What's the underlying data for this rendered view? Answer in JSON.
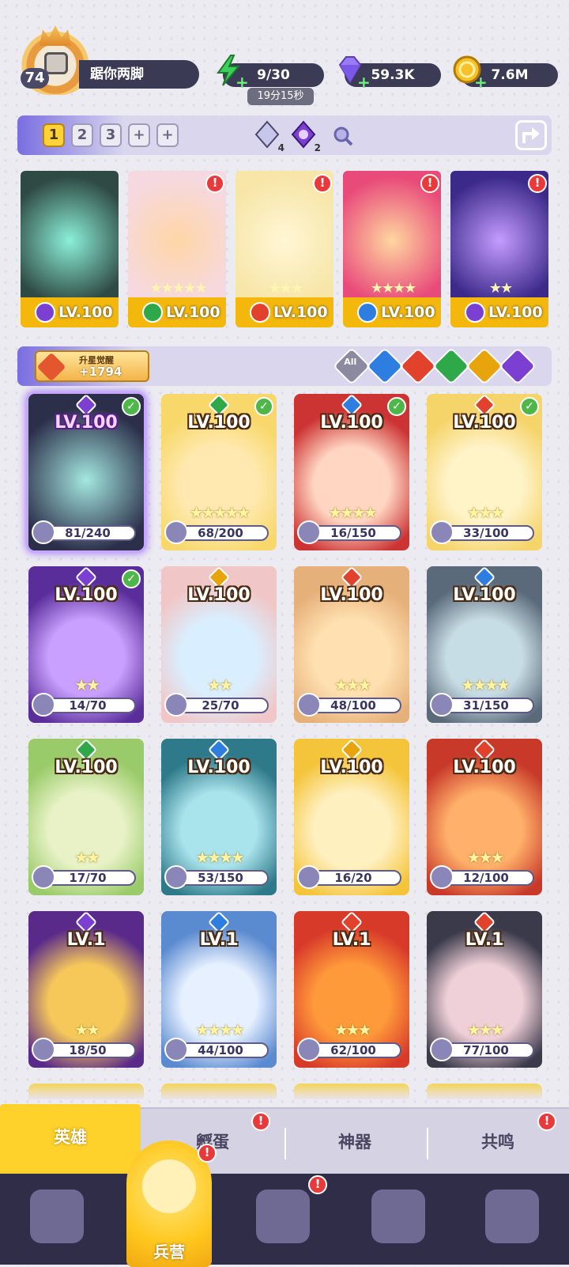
{
  "player": {
    "level": "74",
    "name": "踞你两脚"
  },
  "resources": {
    "energy": {
      "value": "9/30",
      "timer": "19分15秒",
      "icon": "lightning-icon",
      "color": "#3ccf5a"
    },
    "gems": {
      "value": "59.3K",
      "icon": "gem-icon",
      "color": "#8e6cf2"
    },
    "gold": {
      "value": "7.6M",
      "icon": "coin-icon",
      "color": "#f2b318"
    }
  },
  "team_bar": {
    "tabs": [
      "1",
      "2",
      "3",
      "+",
      "+"
    ],
    "active_tab": "1",
    "crystals": [
      {
        "icon": "white-crystal-icon",
        "count": "4"
      },
      {
        "icon": "moon-crystal-icon",
        "count": "2"
      }
    ]
  },
  "team": [
    {
      "level": "LV.100",
      "element": "moon",
      "stars": "",
      "alert": false
    },
    {
      "level": "LV.100",
      "element": "leaf",
      "stars": "★★★★★",
      "alert": true
    },
    {
      "level": "LV.100",
      "element": "fire",
      "stars": "★★★",
      "alert": true
    },
    {
      "level": "LV.100",
      "element": "water",
      "stars": "★★★★",
      "alert": true
    },
    {
      "level": "LV.100",
      "element": "moon",
      "stars": "★★",
      "alert": true
    }
  ],
  "awaken": {
    "label": "升星觉醒",
    "value": "+1794"
  },
  "filters": [
    "All",
    "water",
    "fire",
    "leaf",
    "light",
    "moon"
  ],
  "heroes": [
    {
      "level": "LV.100",
      "element": "moon",
      "stars": "",
      "progress": "81/240",
      "checked": true
    },
    {
      "level": "LV.100",
      "element": "leaf",
      "stars": "★★★★★",
      "progress": "68/200",
      "checked": true
    },
    {
      "level": "LV.100",
      "element": "water",
      "stars": "★★★★",
      "progress": "16/150",
      "checked": true
    },
    {
      "level": "LV.100",
      "element": "fire",
      "stars": "★★★",
      "progress": "33/100",
      "checked": true
    },
    {
      "level": "LV.100",
      "element": "moon",
      "stars": "★★",
      "progress": "14/70",
      "checked": true
    },
    {
      "level": "LV.100",
      "element": "light",
      "stars": "★★",
      "progress": "25/70",
      "checked": false
    },
    {
      "level": "LV.100",
      "element": "fire",
      "stars": "★★★",
      "progress": "48/100",
      "checked": false
    },
    {
      "level": "LV.100",
      "element": "water",
      "stars": "★★★★",
      "progress": "31/150",
      "checked": false
    },
    {
      "level": "LV.100",
      "element": "leaf",
      "stars": "★★",
      "progress": "17/70",
      "checked": false
    },
    {
      "level": "LV.100",
      "element": "water",
      "stars": "★★★★",
      "progress": "53/150",
      "checked": false
    },
    {
      "level": "LV.100",
      "element": "light",
      "stars": "",
      "progress": "16/20",
      "checked": false
    },
    {
      "level": "LV.100",
      "element": "fire",
      "stars": "★★★",
      "progress": "12/100",
      "checked": false
    },
    {
      "level": "LV.1",
      "element": "moon",
      "stars": "★★",
      "progress": "18/50",
      "checked": false
    },
    {
      "level": "LV.1",
      "element": "water",
      "stars": "★★★★",
      "progress": "44/100",
      "checked": false
    },
    {
      "level": "LV.1",
      "element": "fire",
      "stars": "★★★",
      "progress": "62/100",
      "checked": false
    },
    {
      "level": "LV.1",
      "element": "fire",
      "stars": "★★★",
      "progress": "77/100",
      "checked": false
    }
  ],
  "element_colors": {
    "moon": "#7b3fd1",
    "leaf": "#2fa84a",
    "fire": "#e2412b",
    "water": "#2d7ee0",
    "light": "#e8a40c",
    "All": "#8b8aa0"
  },
  "sub_tabs": [
    {
      "label": "英雄",
      "active": true,
      "alert": false
    },
    {
      "label": "孵蛋",
      "active": false,
      "alert": true
    },
    {
      "label": "神器",
      "active": false,
      "alert": false
    },
    {
      "label": "共鸣",
      "active": false,
      "alert": true
    }
  ],
  "nav": [
    {
      "icon": "cards-icon",
      "label": "",
      "active": false,
      "alert": false
    },
    {
      "icon": "barracks-icon",
      "label": "兵营",
      "active": true,
      "alert": true
    },
    {
      "icon": "map-book-icon",
      "label": "",
      "active": false,
      "alert": true
    },
    {
      "icon": "temple-icon",
      "label": "",
      "active": false,
      "alert": false
    },
    {
      "icon": "guild-icon",
      "label": "",
      "active": false,
      "alert": false
    }
  ],
  "alert_mark": "!",
  "check_mark": "✓"
}
